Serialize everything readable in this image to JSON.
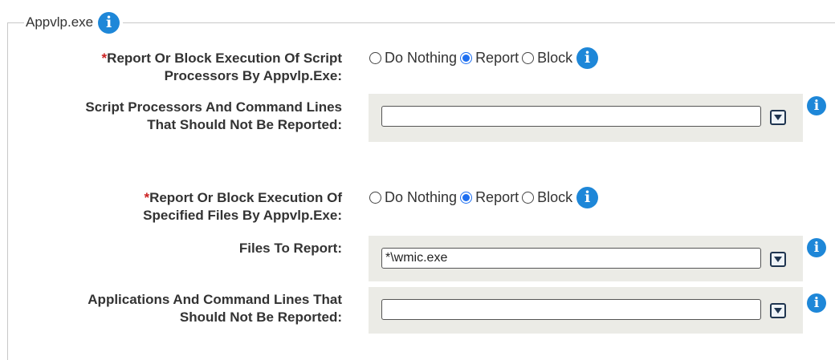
{
  "section": {
    "title": "Appvlp.exe"
  },
  "rows": {
    "script_processors_action": {
      "required": "*",
      "label_line1": "Report Or Block Execution Of Script",
      "label_line2": "Processors By Appvlp.Exe:",
      "options": [
        "Do Nothing",
        "Report",
        "Block"
      ],
      "selected": "Report"
    },
    "script_processors_exclusions": {
      "label_line1": "Script Processors And Command Lines",
      "label_line2": "That Should Not Be Reported:",
      "value": ""
    },
    "specified_files_action": {
      "required": "*",
      "label_line1": "Report Or Block Execution Of",
      "label_line2": "Specified Files By Appvlp.Exe:",
      "options": [
        "Do Nothing",
        "Report",
        "Block"
      ],
      "selected": "Report"
    },
    "files_to_report": {
      "label": "Files To Report:",
      "value": "*\\wmic.exe"
    },
    "applications_exclusions": {
      "label_line1": "Applications And Command Lines That",
      "label_line2": "Should Not Be Reported:",
      "value": ""
    }
  },
  "icons": {
    "info": "info-icon",
    "info_glyph": "i",
    "dropdown": "dropdown-arrow-icon"
  },
  "colors": {
    "info_blue": "#1e87d8",
    "required_red": "#cc2222",
    "panel_gray": "#ebebe6",
    "radio_blue": "#1e6ff0"
  }
}
